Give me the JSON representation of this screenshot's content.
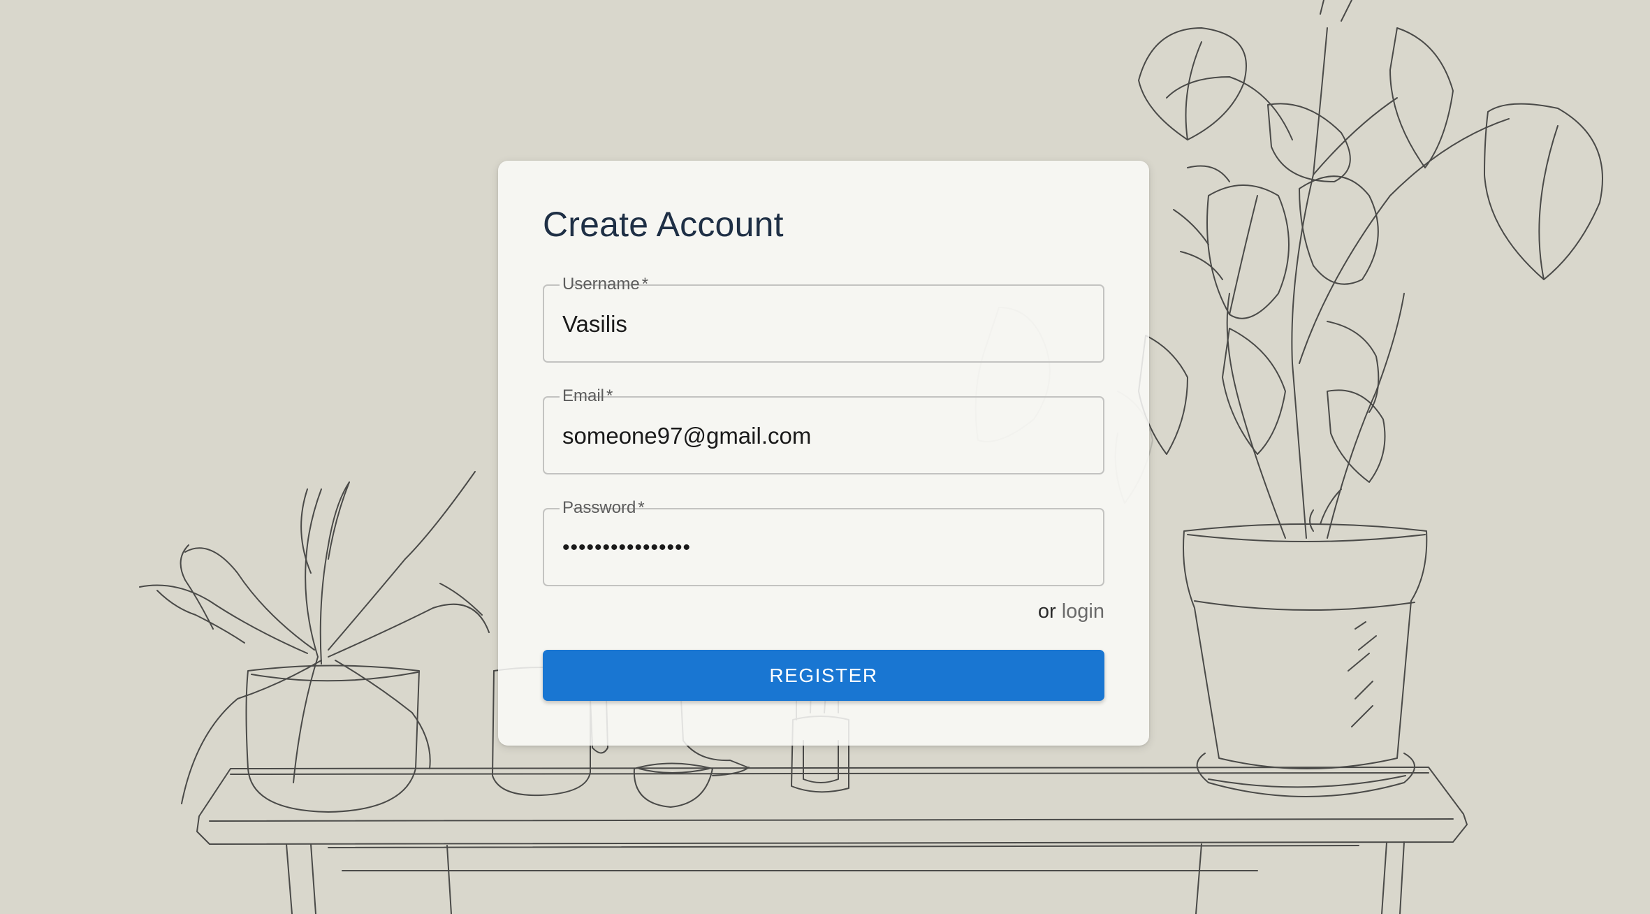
{
  "page": {
    "background_color": "#d9d7cc",
    "accent_color": "#1976d2"
  },
  "form": {
    "title": "Create Account",
    "fields": [
      {
        "label": "Username",
        "required_mark": "*",
        "value": "Vasilis",
        "type": "text"
      },
      {
        "label": "Email",
        "required_mark": "*",
        "value": "someone97@gmail.com",
        "type": "email"
      },
      {
        "label": "Password",
        "required_mark": "*",
        "value": "••••••••••••••••",
        "type": "password"
      }
    ],
    "alt_prefix": "or",
    "alt_link": "login",
    "submit_label": "REGISTER"
  },
  "background": {
    "illustration": "line-drawing-plants-on-table"
  }
}
